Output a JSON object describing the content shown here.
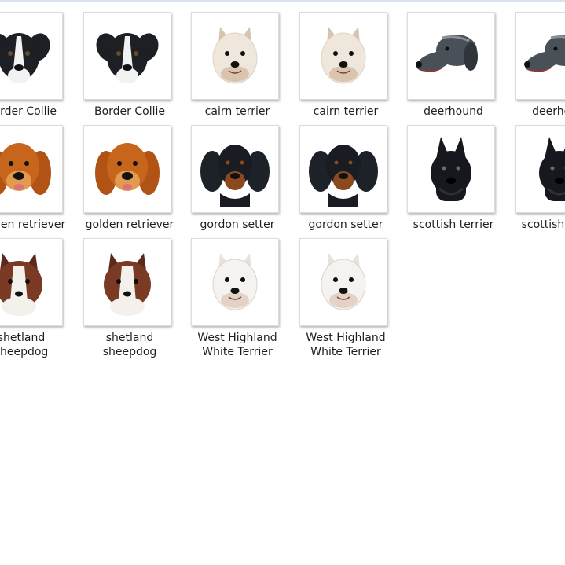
{
  "files": [
    {
      "label": "Border Collie",
      "icon": "border-collie-thumbnail",
      "colors": {
        "fur": "#1c1f24",
        "accent": "#f2f2f2",
        "ears": "#1c1f24"
      }
    },
    {
      "label": "Border Collie",
      "icon": "border-collie-thumbnail",
      "colors": {
        "fur": "#1c1f24",
        "accent": "#f2f2f2",
        "ears": "#1c1f24"
      }
    },
    {
      "label": "cairn terrier",
      "icon": "cairn-terrier-thumbnail",
      "colors": {
        "fur": "#efe7dc",
        "accent": "#c9a58a",
        "ears": "#d8c3ae"
      }
    },
    {
      "label": "cairn terrier",
      "icon": "cairn-terrier-thumbnail",
      "colors": {
        "fur": "#efe7dc",
        "accent": "#c9a58a",
        "ears": "#d8c3ae"
      }
    },
    {
      "label": "deerhound",
      "icon": "deerhound-thumbnail",
      "colors": {
        "fur": "#4a5058",
        "accent": "#8a9098",
        "ears": "#30353b"
      }
    },
    {
      "label": "deerhound",
      "icon": "deerhound-thumbnail",
      "colors": {
        "fur": "#4a5058",
        "accent": "#8a9098",
        "ears": "#30353b"
      }
    },
    {
      "label": "golden retriever",
      "icon": "golden-retriever-thumbnail",
      "colors": {
        "fur": "#c8651c",
        "accent": "#e39a4e",
        "ears": "#b05314"
      }
    },
    {
      "label": "golden retriever",
      "icon": "golden-retriever-thumbnail",
      "colors": {
        "fur": "#c8651c",
        "accent": "#e39a4e",
        "ears": "#b05314"
      }
    },
    {
      "label": "gordon setter",
      "icon": "gordon-setter-thumbnail",
      "colors": {
        "fur": "#191c22",
        "accent": "#8a4a1e",
        "ears": "#1d2128"
      }
    },
    {
      "label": "gordon setter",
      "icon": "gordon-setter-thumbnail",
      "colors": {
        "fur": "#191c22",
        "accent": "#8a4a1e",
        "ears": "#1d2128"
      }
    },
    {
      "label": "scottish terrier",
      "icon": "scottish-terrier-thumbnail",
      "colors": {
        "fur": "#16181d",
        "accent": "#2c3038",
        "ears": "#16181d"
      }
    },
    {
      "label": "scottish terrier",
      "icon": "scottish-terrier-thumbnail",
      "colors": {
        "fur": "#16181d",
        "accent": "#2c3038",
        "ears": "#16181d"
      }
    },
    {
      "label": "shetland\nsheepdog",
      "icon": "shetland-sheepdog-thumbnail",
      "colors": {
        "fur": "#7a3a24",
        "accent": "#f4f0ec",
        "ears": "#5a2a1a"
      }
    },
    {
      "label": "shetland\nsheepdog",
      "icon": "shetland-sheepdog-thumbnail",
      "colors": {
        "fur": "#7a3a24",
        "accent": "#f4f0ec",
        "ears": "#5a2a1a"
      }
    },
    {
      "label": "West Highland\nWhite Terrier",
      "icon": "west-highland-white-terrier-thumbnail",
      "colors": {
        "fur": "#f5f3f0",
        "accent": "#d7b7a4",
        "ears": "#e8e2dc"
      }
    },
    {
      "label": "West Highland\nWhite Terrier",
      "icon": "west-highland-white-terrier-thumbnail",
      "colors": {
        "fur": "#f5f3f0",
        "accent": "#d7b7a4",
        "ears": "#e8e2dc"
      }
    }
  ]
}
